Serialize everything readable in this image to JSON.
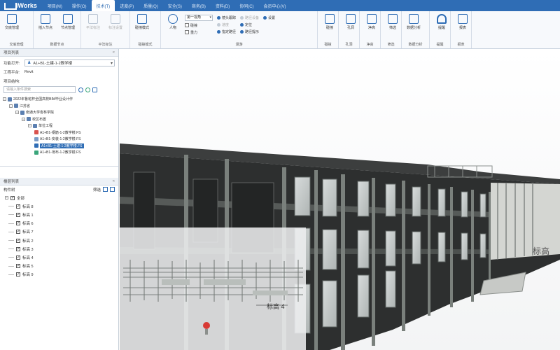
{
  "app": {
    "name": "iWorks"
  },
  "menu": [
    {
      "label": "项目(M)",
      "active": false
    },
    {
      "label": "操作(O)",
      "active": false
    },
    {
      "label": "技术(T)",
      "active": true
    },
    {
      "label": "进度(P)",
      "active": false
    },
    {
      "label": "质量(Q)",
      "active": false
    },
    {
      "label": "安全(S)",
      "active": false
    },
    {
      "label": "商务(B)",
      "active": false
    },
    {
      "label": "资料(D)",
      "active": false
    },
    {
      "label": "协同(C)",
      "active": false
    },
    {
      "label": "会员中心(V)",
      "active": false
    }
  ],
  "ribbon": {
    "groups": [
      {
        "title": "交底管理",
        "buttons": [
          {
            "label": "交底管理",
            "disabled": false
          }
        ]
      },
      {
        "title": "数据节点",
        "buttons": [
          {
            "label": "插入节点",
            "disabled": false
          },
          {
            "label": "节点管理",
            "disabled": false
          }
        ]
      },
      {
        "title": "平法标注",
        "buttons": [
          {
            "label": "平法标注",
            "disabled": true
          },
          {
            "label": "标注设置",
            "disabled": true
          }
        ]
      },
      {
        "title": "碰撞模式",
        "buttons": [
          {
            "label": "碰撞模式",
            "disabled": false
          }
        ]
      },
      {
        "title": "漫游",
        "person": "人物",
        "viewSelect": "第一视角",
        "checks": [
          "碰撞",
          "重力"
        ],
        "items": [
          {
            "label": "镜头跟踪",
            "off": false
          },
          {
            "label": "速度",
            "off": true
          },
          {
            "label": "指定路径",
            "off": false
          },
          {
            "label": "路径设备",
            "off": true
          },
          {
            "label": "定位",
            "off": false
          },
          {
            "label": "路径提示",
            "off": false
          },
          {
            "label": "设置",
            "off": false
          }
        ]
      },
      {
        "title": "碰撞",
        "buttons": [
          {
            "label": "碰撞",
            "disabled": false
          }
        ]
      },
      {
        "title": "孔洞",
        "buttons": [
          {
            "label": "孔洞",
            "disabled": false
          }
        ]
      },
      {
        "title": "净高",
        "buttons": [
          {
            "label": "净高",
            "disabled": false
          }
        ]
      },
      {
        "title": "筛选",
        "buttons": [
          {
            "label": "筛选",
            "disabled": false
          }
        ]
      },
      {
        "title": "数据分析",
        "buttons": [
          {
            "label": "数据分析",
            "disabled": false
          }
        ]
      },
      {
        "title": "提醒",
        "buttons": [
          {
            "label": "提醒",
            "disabled": false
          }
        ]
      },
      {
        "title": "报表",
        "buttons": [
          {
            "label": "报表",
            "disabled": false
          }
        ]
      }
    ]
  },
  "project_panel": {
    "title": "项目列表",
    "function_label": "功能打开:",
    "function_value": "A1+B1-土建-1-2教学楼",
    "engine_label": "工程平台:",
    "engine_value": "Revit",
    "structure_label": "项目结构:",
    "search_placeholder": "请输入条件搜索",
    "tree": [
      {
        "level": 0,
        "label": "2022年鲁班杯全国高校BIM毕业设计作"
      },
      {
        "level": 1,
        "label": "江苏省"
      },
      {
        "level": 2,
        "label": "南通大学杏林学院"
      },
      {
        "level": 3,
        "label": "校区布置"
      },
      {
        "level": 4,
        "label": "单位工程"
      },
      {
        "level": 5,
        "label": "A1+B1-钢筋-1-2教学楼.FS",
        "selected": false,
        "color": "#d9534f"
      },
      {
        "level": 5,
        "label": "A1+B1-安装-1-2教学楼.FS",
        "selected": false,
        "color": "#7a9cc6"
      },
      {
        "level": 5,
        "label": "A1+B1-土建-1-2教学楼.FS",
        "selected": true,
        "color": "#2f6db5"
      },
      {
        "level": 5,
        "label": "A1+B1-场布-1-2教学楼.FS",
        "selected": false,
        "color": "#3aa57a"
      }
    ]
  },
  "floor_panel": {
    "title": "楼层列表",
    "filter_label": "构件树",
    "filter_btn": "筛选",
    "floors": [
      "全部",
      "标高 8",
      "标高 1",
      "标高 6",
      "标高 7",
      "标高 2",
      "标高 3",
      "标高 4",
      "标高 5",
      "标高 9"
    ]
  },
  "viewport": {
    "level_tag": "标高 4",
    "edge_label": "标高"
  }
}
